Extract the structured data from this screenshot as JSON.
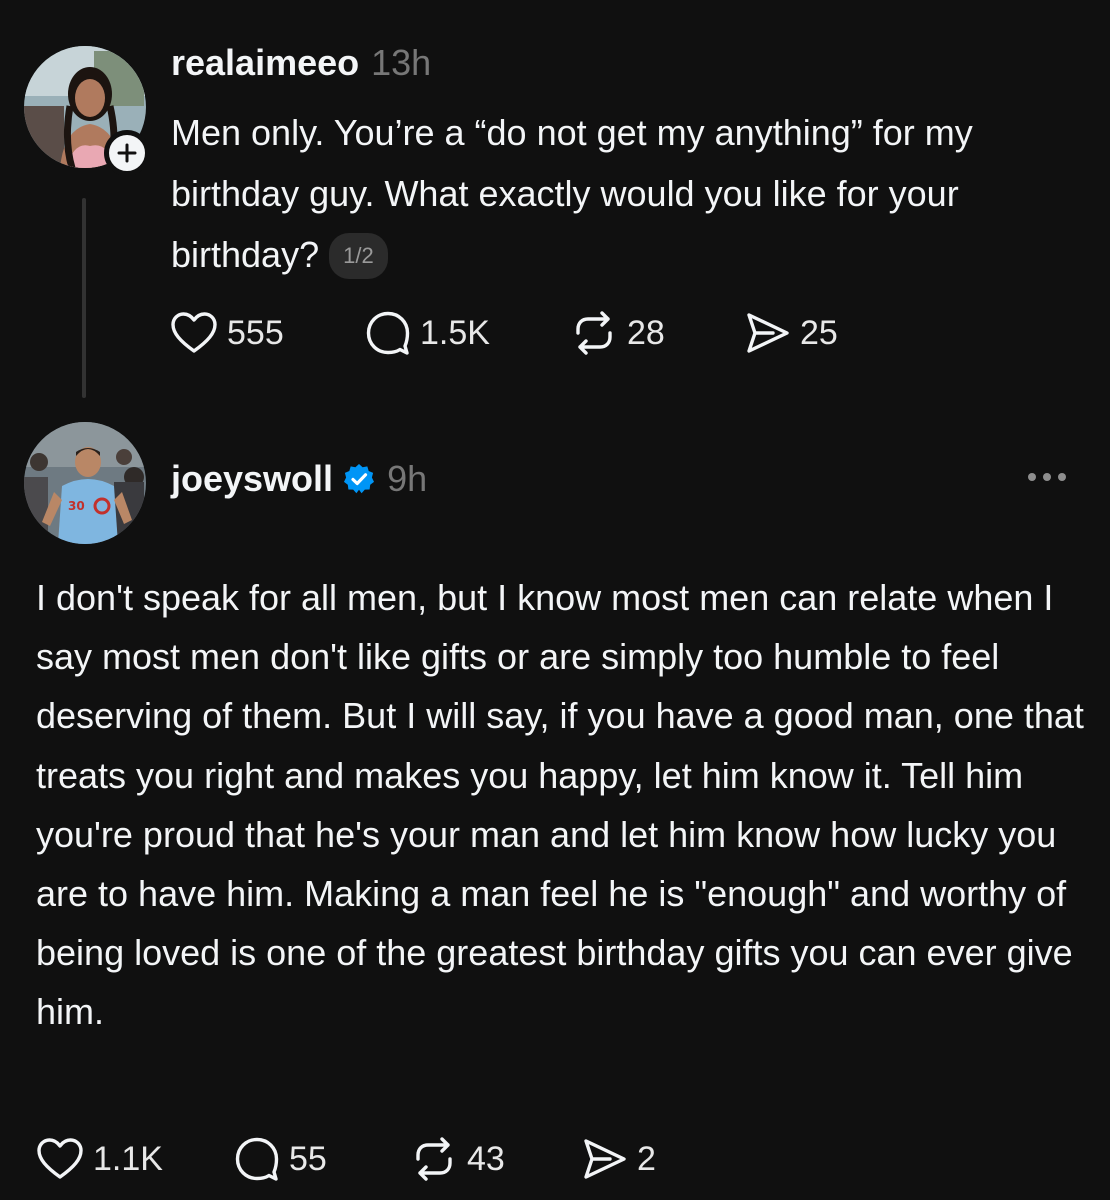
{
  "post1": {
    "username": "realaimeeo",
    "time": "13h",
    "text": "Men only. You’re a “do not get my anything” for my birthday guy. What exactly would you like for your birthday?",
    "page_indicator": "1/2",
    "stats": {
      "likes": "555",
      "replies": "1.5K",
      "reposts": "28",
      "shares": "25"
    }
  },
  "post2": {
    "username": "joeyswoll",
    "time": "9h",
    "verified": true,
    "text": "I don't speak for all men, but I know most men can relate when I say most men don't like gifts or are simply too humble to feel deserving of them. But I will say, if you have a good man, one that treats you right and makes you happy, let him know it. Tell him you're proud that he's your man and let him know how lucky you are to have him. Making a man feel he is \"enough\" and worthy of being loved is one of the greatest birthday gifts you can ever give him.",
    "stats": {
      "likes": "1.1K",
      "replies": "55",
      "reposts": "43",
      "shares": "2"
    }
  },
  "colors": {
    "background": "#101010",
    "text": "#f3f5f7",
    "secondary": "#777777",
    "verified": "#0095f6"
  },
  "icons": [
    "plus-icon",
    "heart-icon",
    "comment-icon",
    "repost-icon",
    "share-icon",
    "verified-icon",
    "more-icon"
  ]
}
